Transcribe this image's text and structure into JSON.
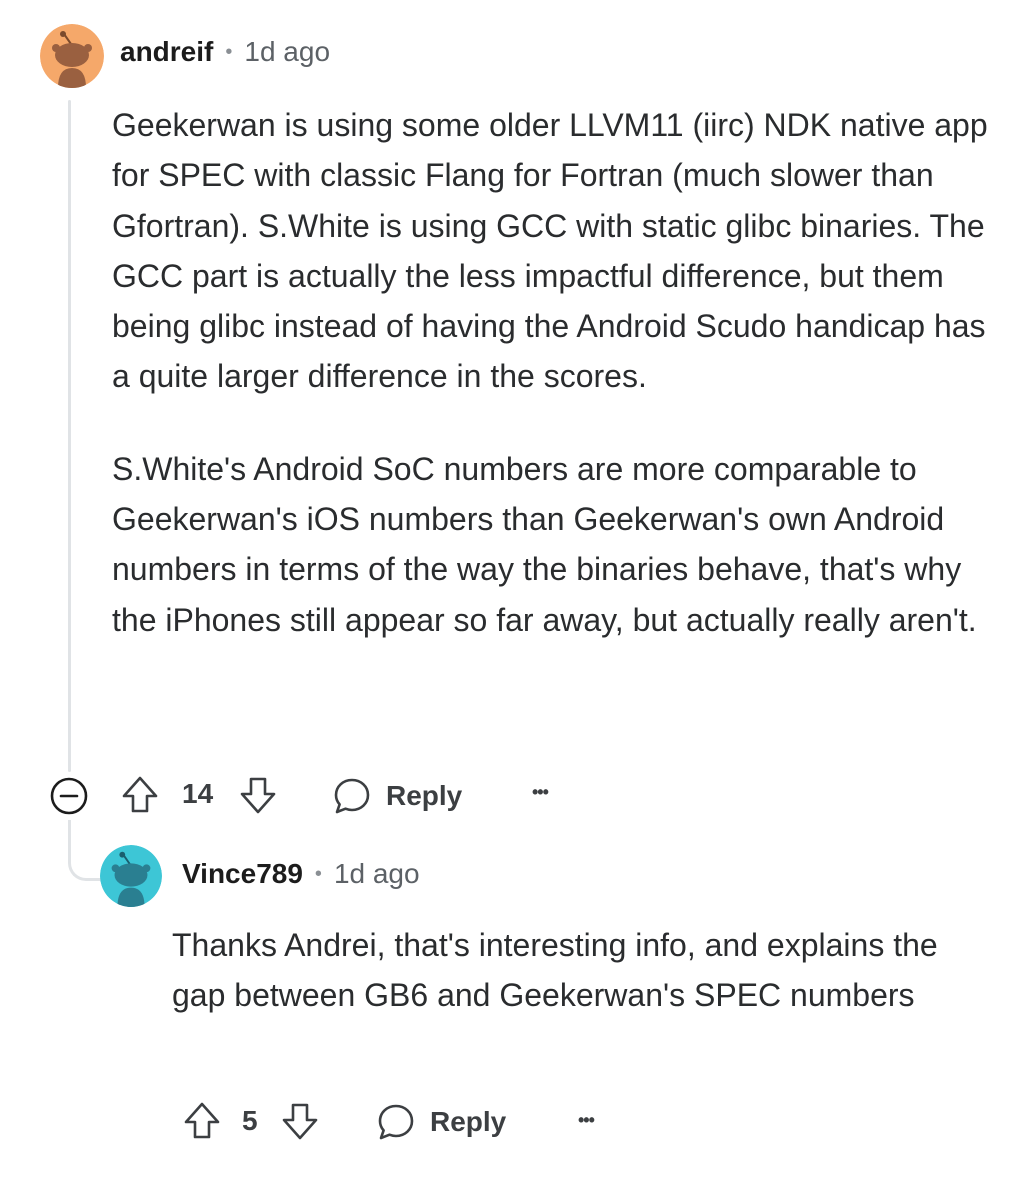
{
  "comment": {
    "author": "andreif",
    "separator": "•",
    "age": "1d ago",
    "paragraphs": [
      "Geekerwan is using some older LLVM11 (iirc) NDK native app for SPEC with classic Flang for Fortran (much slower than Gfortran). S.White is using GCC with static glibc binaries. The GCC part is actually the less impactful difference, but them being glibc instead of having the Android Scudo handicap has a quite larger difference in the scores.",
      "S.White's Android SoC numbers are more comparable to Geekerwan's iOS numbers than Geekerwan's own Android numbers in terms of the way the binaries behave, that's why the iPhones still appear so far away, but actually really aren't."
    ],
    "votes": "14",
    "reply_label": "Reply",
    "more_label": "•••",
    "avatar_color": "#f5a86a"
  },
  "reply": {
    "author": "Vince789",
    "separator": "•",
    "age": "1d ago",
    "text": "Thanks Andrei, that's interesting info, and explains the gap between GB6 and Geekerwan's SPEC numbers",
    "votes": "5",
    "reply_label": "Reply",
    "more_label": "•••",
    "avatar_color": "#3dc6d6"
  }
}
